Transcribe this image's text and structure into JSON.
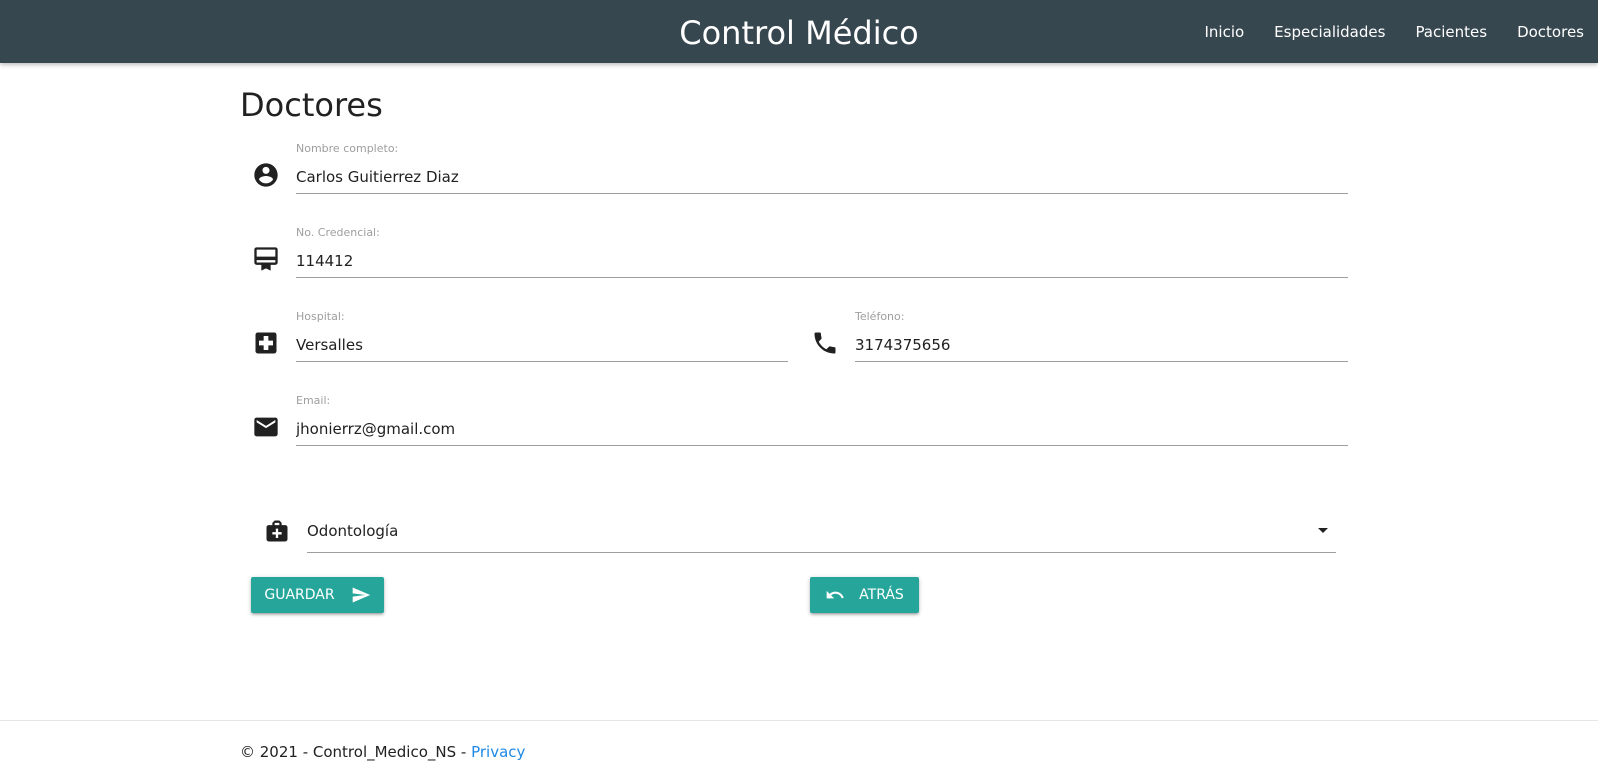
{
  "header": {
    "brand": "Control Médico",
    "nav": [
      "Inicio",
      "Especialidades",
      "Pacientes",
      "Doctores"
    ]
  },
  "page": {
    "title": "Doctores"
  },
  "form": {
    "nombre": {
      "label": "Nombre completo:",
      "value": "Carlos Guitierrez Diaz",
      "icon": "account-circle-icon"
    },
    "credencial": {
      "label": "No. Credencial:",
      "value": "114412",
      "icon": "card-membership-icon"
    },
    "hospital": {
      "label": "Hospital:",
      "value": "Versalles",
      "icon": "local-hospital-icon"
    },
    "telefono": {
      "label": "Teléfono:",
      "value": "3174375656",
      "icon": "phone-icon"
    },
    "email": {
      "label": "Email:",
      "value": "jhonierrz@gmail.com",
      "icon": "email-icon"
    },
    "especialidad": {
      "value": "Odontología",
      "icon": "medical-bag-icon"
    }
  },
  "buttons": {
    "guardar": "GUARDAR",
    "atras": "ATRÁS"
  },
  "footer": {
    "text": "© 2021 - Control_Medico_NS - ",
    "link": "Privacy"
  },
  "colors": {
    "navbar": "#37474f",
    "accent": "#26a69a",
    "link": "#1e88e5"
  }
}
